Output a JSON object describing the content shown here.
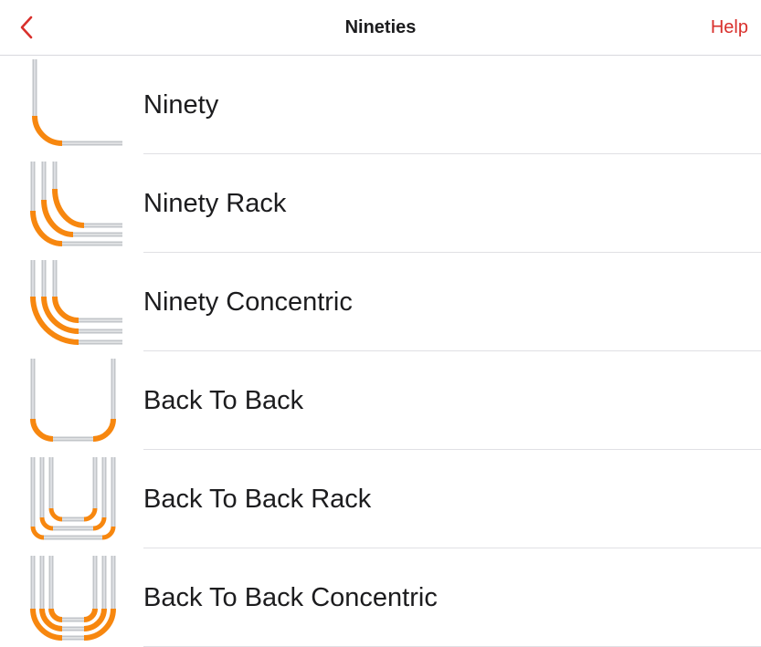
{
  "navbar": {
    "back_icon": "chevron-left-icon",
    "title": "Nineties",
    "help_label": "Help"
  },
  "colors": {
    "accent": "#d9302c",
    "conduit": "#c2c5c9",
    "bend": "#f7870f"
  },
  "items": [
    {
      "label": "Ninety",
      "icon": "ninety-icon"
    },
    {
      "label": "Ninety Rack",
      "icon": "ninety-rack-icon"
    },
    {
      "label": "Ninety Concentric",
      "icon": "ninety-concentric-icon"
    },
    {
      "label": "Back To Back",
      "icon": "back-to-back-icon"
    },
    {
      "label": "Back To Back Rack",
      "icon": "back-to-back-rack-icon"
    },
    {
      "label": "Back To Back Concentric",
      "icon": "back-to-back-concentric-icon"
    }
  ]
}
